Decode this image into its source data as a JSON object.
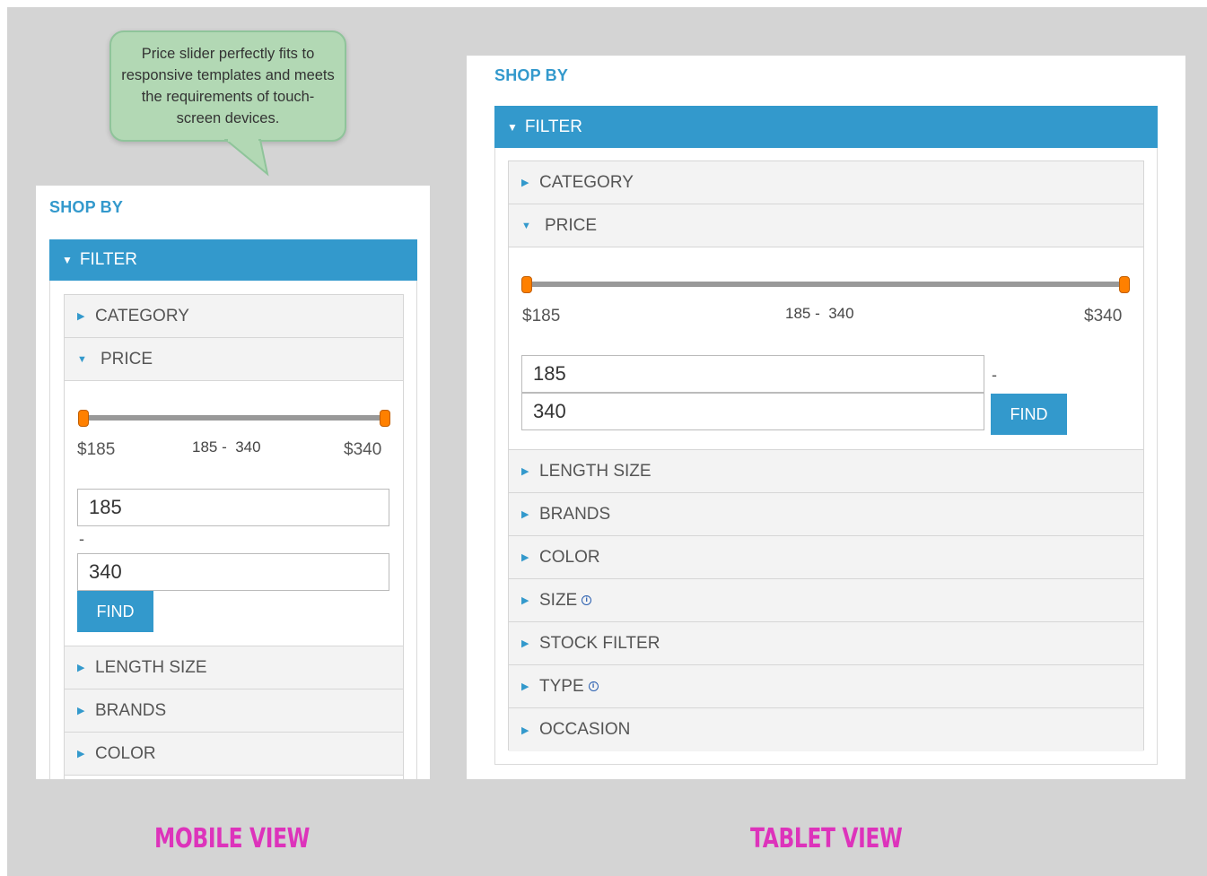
{
  "callout": {
    "text": "Price slider perfectly fits to responsive templates and meets the requirements of touch-screen devices."
  },
  "mobile": {
    "shop_by": "SHOP BY",
    "filter": "FILTER",
    "category": "CATEGORY",
    "price": "PRICE",
    "min_label": "$185",
    "range_label": "185 -  340",
    "max_label": "$340",
    "min_value": "185",
    "separator": "-",
    "max_value": "340",
    "find": "FIND",
    "items": [
      "LENGTH SIZE",
      "BRANDS",
      "COLOR"
    ],
    "view_label": "MOBILE VIEW"
  },
  "tablet": {
    "shop_by": "SHOP BY",
    "filter": "FILTER",
    "category": "CATEGORY",
    "price": "PRICE",
    "min_label": "$185",
    "range_label": "185 -  340",
    "max_label": "$340",
    "min_value": "185",
    "separator": "-",
    "max_value": "340",
    "find": "FIND",
    "items": [
      "LENGTH SIZE",
      "BRANDS",
      "COLOR",
      "SIZE",
      "STOCK FILTER",
      "TYPE",
      "OCCASION"
    ],
    "view_label": "TABLET VIEW"
  },
  "slider": {
    "min": 185,
    "max": 340,
    "low": 185,
    "high": 340
  },
  "colors": {
    "accent": "#3399cc",
    "handle": "#ff8000",
    "label": "#dd33bb",
    "callout": "#b2d8b4"
  },
  "icons": {
    "collapsed": "caret-right-icon",
    "expanded": "caret-down-icon",
    "info": "info-icon"
  }
}
